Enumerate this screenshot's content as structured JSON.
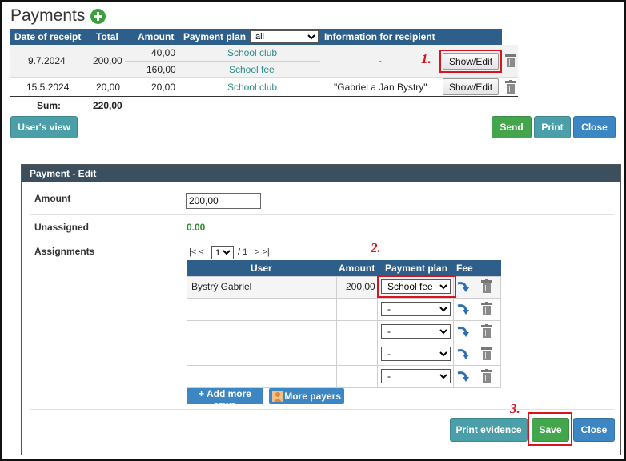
{
  "page": {
    "title": "Payments"
  },
  "payments_table": {
    "headers": {
      "date": "Date of receipt",
      "total": "Total",
      "amount": "Amount",
      "plan": "Payment plan",
      "info": "Information for recipient"
    },
    "plan_filter": {
      "selected": "all"
    },
    "rows": [
      {
        "date": "9.7.2024",
        "total": "200,00",
        "parts": [
          {
            "amount": "40,00",
            "plan": "School club"
          },
          {
            "amount": "160,00",
            "plan": "School fee"
          }
        ],
        "info": "-",
        "action_label": "Show/Edit"
      },
      {
        "date": "15.5.2024",
        "total": "20,00",
        "parts": [
          {
            "amount": "20,00",
            "plan": "School club"
          }
        ],
        "info": "\"Gabriel a Jan Bystry\"",
        "action_label": "Show/Edit"
      }
    ],
    "sum_label": "Sum:",
    "sum_value": "220,00"
  },
  "top_buttons": {
    "users_view": "User's view",
    "send": "Send",
    "print": "Print",
    "close": "Close"
  },
  "steps": {
    "s1": "1.",
    "s2": "2.",
    "s3": "3."
  },
  "edit_panel": {
    "title": "Payment - Edit",
    "amount_label": "Amount",
    "amount_value": "200,00",
    "unassigned_label": "Unassigned",
    "unassigned_value": "0.00",
    "assignments_label": "Assignments",
    "pager": {
      "first_prev": "|< <",
      "page": "1",
      "of": "/ 1",
      "next_last": "> >|"
    },
    "grid_headers": {
      "user": "User",
      "amount": "Amount",
      "plan": "Payment plan",
      "fee": "Fee"
    },
    "grid_rows": [
      {
        "user": "Bystrý Gabriel",
        "amount": "200,00",
        "plan": "School fee"
      },
      {
        "user": "",
        "amount": "",
        "plan": "-"
      },
      {
        "user": "",
        "amount": "",
        "plan": "-"
      },
      {
        "user": "",
        "amount": "",
        "plan": "-"
      },
      {
        "user": "",
        "amount": "",
        "plan": "-"
      }
    ],
    "add_rows": "+ Add more rows",
    "more_payers": "More payers",
    "print_evidence": "Print evidence",
    "save": "Save",
    "close": "Close"
  },
  "colors": {
    "header_blue": "#2e5f8b",
    "panel_header": "#3b4f5f",
    "link_teal": "#2a8a8a",
    "save_green": "#43a64c",
    "annotation_red": "#d8141c",
    "unassigned_green": "#2e8b2e"
  },
  "icons": [
    "add-icon",
    "trash-icon",
    "fee-arrow-icon",
    "person-icon",
    "chevron-down-icon"
  ]
}
